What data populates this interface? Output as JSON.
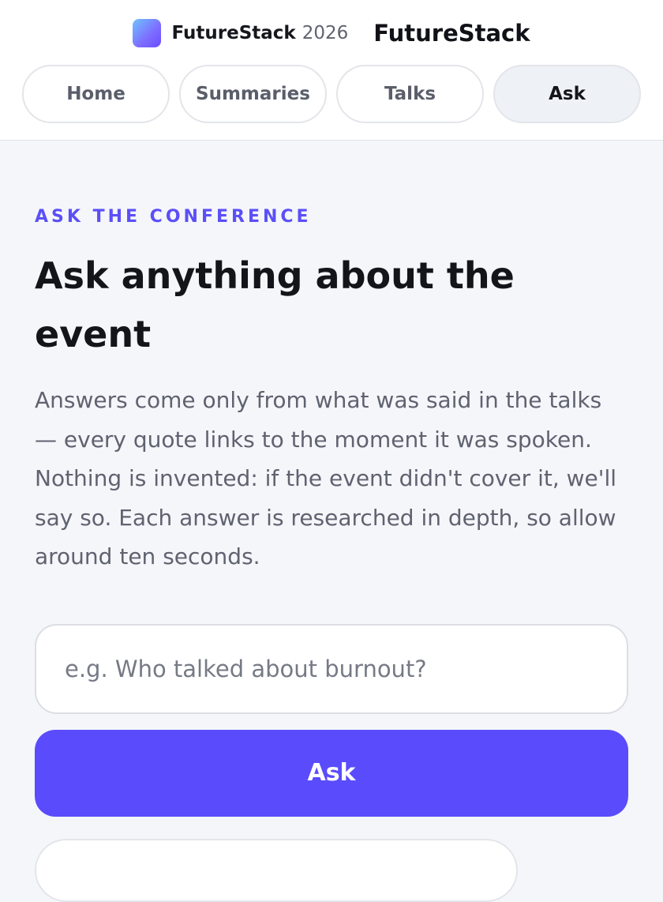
{
  "brand": {
    "name": "FutureStack",
    "year": "2026",
    "title": "FutureStack"
  },
  "nav": {
    "tabs": [
      {
        "label": "Home"
      },
      {
        "label": "Summaries"
      },
      {
        "label": "Talks"
      },
      {
        "label": "Ask",
        "active": true
      }
    ]
  },
  "main": {
    "eyebrow": "ASK THE CONFERENCE",
    "title": "Ask anything about the event",
    "description": "Answers come only from what was said in the talks — every quote links to the moment it was spoken. Nothing is invented: if the event didn't cover it, we'll say so. Each answer is researched in depth, so allow around ten seconds.",
    "input": {
      "value": "",
      "placeholder": "e.g. Who talked about burnout?"
    },
    "ask_button_label": "Ask"
  },
  "colors": {
    "accent": "#5a4cfc",
    "eyebrow": "#5b4ff8",
    "background": "#f5f6fa"
  }
}
